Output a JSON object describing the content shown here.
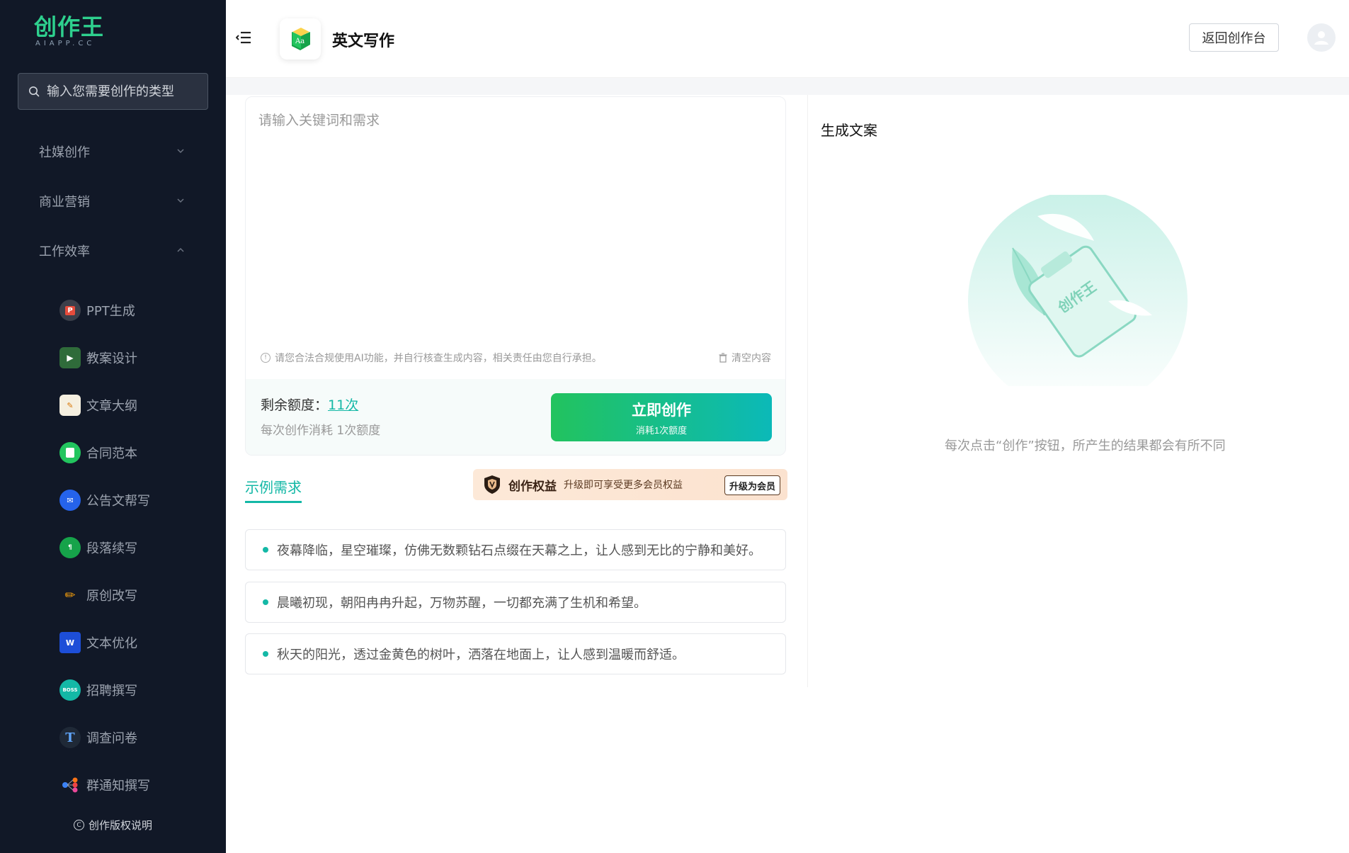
{
  "sidebar": {
    "logo_text": "创作王",
    "logo_sub": "AIAPP.CC",
    "search_placeholder": "输入您需要创作的类型",
    "groups": [
      {
        "label": "社媒创作"
      },
      {
        "label": "商业营销"
      },
      {
        "label": "工作效率"
      }
    ],
    "items": [
      {
        "label": "PPT生成",
        "icon": "ppt-icon"
      },
      {
        "label": "教案设计",
        "icon": "play-icon"
      },
      {
        "label": "文章大纲",
        "icon": "pencil-note-icon"
      },
      {
        "label": "合同范本",
        "icon": "notebook-icon"
      },
      {
        "label": "公告文帮写",
        "icon": "mail-icon"
      },
      {
        "label": "段落续写",
        "icon": "paragraph-icon"
      },
      {
        "label": "原创改写",
        "icon": "pencil-icon"
      },
      {
        "label": "文本优化",
        "icon": "word-icon"
      },
      {
        "label": "招聘撰写",
        "icon": "boss-icon"
      },
      {
        "label": "调查问卷",
        "icon": "t-icon"
      },
      {
        "label": "群通知撰写",
        "icon": "nodes-icon"
      }
    ],
    "copyright": "创作版权说明"
  },
  "header": {
    "title": "英文写作",
    "back_button": "返回创作台"
  },
  "editor": {
    "placeholder": "请输入关键词和需求",
    "notice": "请您合法合规使用AI功能，并自行核查生成内容，相关责任由您自行承担。",
    "clear": "清空内容",
    "quota_label": "剩余额度：",
    "quota_value": "11次",
    "quota_sub": "每次创作消耗 1次额度",
    "create_main": "立即创作",
    "create_sub": "消耗1次额度"
  },
  "examples": {
    "tab": "示例需求",
    "items": [
      "夜幕降临，星空璀璨，仿佛无数颗钻石点缀在天幕之上，让人感到无比的宁静和美好。",
      "晨曦初现，朝阳冉冉升起，万物苏醒，一切都充满了生机和希望。",
      "秋天的阳光，透过金黄色的树叶，洒落在地面上，让人感到温暖而舒适。"
    ]
  },
  "vip": {
    "title": "创作权益",
    "desc": "升级即可享受更多会员权益",
    "button": "升级为会员"
  },
  "output": {
    "title": "生成文案",
    "illustration_text": "创作王",
    "hint": "每次点击“创作”按钮，所产生的结果都会有所不同"
  },
  "colors": {
    "sidebar_bg": "#111827",
    "accent": "#14b8a6",
    "brand_green": "#2ed08e"
  }
}
